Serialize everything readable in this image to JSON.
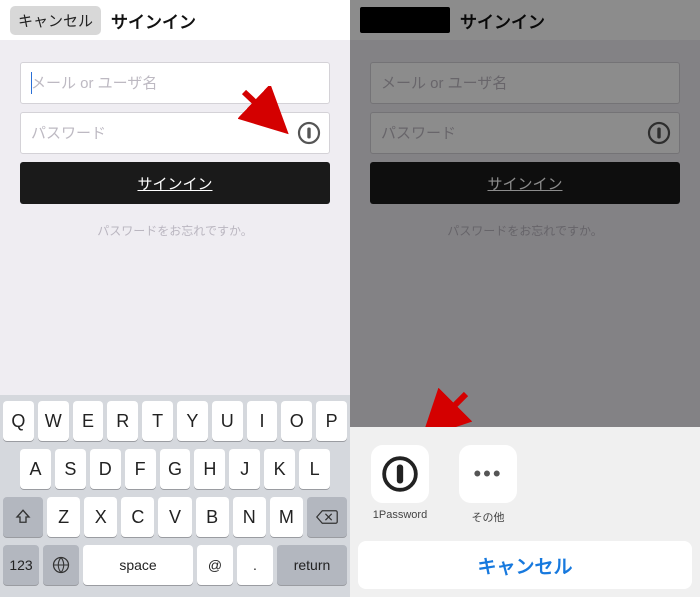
{
  "left": {
    "cancel_label": "キャンセル",
    "title": "サインイン",
    "email_placeholder": "メール or ユーザ名",
    "password_placeholder": "パスワード",
    "signin_label": "サインイン",
    "forgot_label": "パスワードをお忘れですか。",
    "keyboard": {
      "row1": [
        "Q",
        "W",
        "E",
        "R",
        "T",
        "Y",
        "U",
        "I",
        "O",
        "P"
      ],
      "row2": [
        "A",
        "S",
        "D",
        "F",
        "G",
        "H",
        "J",
        "K",
        "L"
      ],
      "row3": [
        "Z",
        "X",
        "C",
        "V",
        "B",
        "N",
        "M"
      ],
      "key_123": "123",
      "key_space": "space",
      "key_at": "@",
      "key_dot": ".",
      "key_return": "return"
    },
    "icons": {
      "onepassword": "onepassword-icon",
      "shift": "shift-icon",
      "backspace": "backspace-icon",
      "globe": "globe-icon"
    }
  },
  "right": {
    "title": "サインイン",
    "email_placeholder": "メール or ユーザ名",
    "password_placeholder": "パスワード",
    "signin_label": "サインイン",
    "forgot_label": "パスワードをお忘れですか。",
    "sheet": {
      "item1_label": "1Password",
      "item2_label": "その他",
      "cancel_label": "キャンセル"
    },
    "icons": {
      "onepassword": "onepassword-icon",
      "more": "more-icon"
    }
  },
  "colors": {
    "accent_blue": "#1779de",
    "button_black": "#1a1a1a",
    "arrow_red": "#d40000"
  }
}
